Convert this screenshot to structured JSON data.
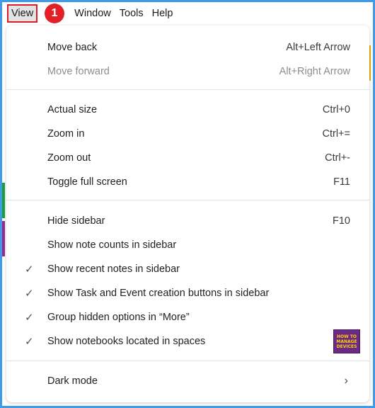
{
  "menubar": {
    "items": [
      "View",
      "Window",
      "Tools",
      "Help"
    ]
  },
  "step_badge": "1",
  "view_menu": {
    "rows": [
      {
        "label": "Move back",
        "shortcut": "Alt+Left Arrow"
      },
      {
        "label": "Move forward",
        "shortcut": "Alt+Right Arrow",
        "disabled": true
      },
      {
        "label": "Actual size",
        "shortcut": "Ctrl+0"
      },
      {
        "label": "Zoom in",
        "shortcut": "Ctrl+="
      },
      {
        "label": "Zoom out",
        "shortcut": "Ctrl+-"
      },
      {
        "label": "Toggle full screen",
        "shortcut": "F11"
      },
      {
        "label": "Hide sidebar",
        "shortcut": "F10"
      },
      {
        "label": "Show note counts in sidebar",
        "checked": false
      },
      {
        "label": "Show recent notes in sidebar",
        "checked": true
      },
      {
        "label": "Show Task and Event creation buttons in sidebar",
        "checked": true
      },
      {
        "label": "Group hidden options in “More”",
        "checked": true
      },
      {
        "label": "Show notebooks located in spaces",
        "checked": true
      },
      {
        "label": "Dark mode",
        "submenu": true
      }
    ],
    "check_glyph": "✓",
    "submenu_glyph": "›"
  },
  "watermark_logo": {
    "line1": "HOW TO",
    "line2": "MANAGE",
    "line3": "DEVICES"
  },
  "colors": {
    "border": "#3d9be9",
    "highlight": "#d91e2a",
    "badge": "#e22027",
    "logo_bg": "#6a2a85"
  }
}
